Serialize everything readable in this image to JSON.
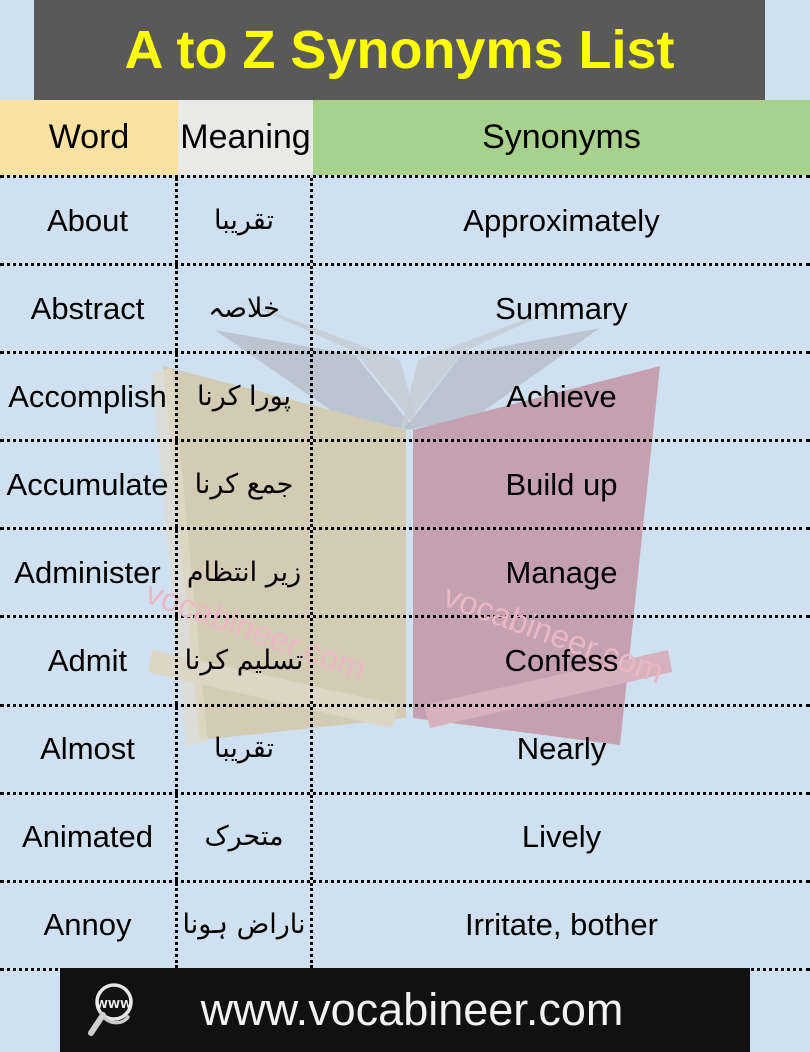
{
  "title": {
    "text": "A to Z Synonyms List",
    "bar_color": "#595959",
    "text_color": "#ffff00"
  },
  "table": {
    "headers": {
      "word": "Word",
      "meaning": "Meaning",
      "synonyms": "Synonyms"
    },
    "header_colors": {
      "word": "#fce2a2",
      "meaning": "#e9e9e7",
      "synonyms": "#a9d18e"
    },
    "rows": [
      {
        "word": "About",
        "meaning": "تقریبا",
        "synonyms": "Approximately"
      },
      {
        "word": "Abstract",
        "meaning": "خلاصہ",
        "synonyms": "Summary"
      },
      {
        "word": "Accomplish",
        "meaning": "پورا کرنا",
        "synonyms": "Achieve"
      },
      {
        "word": "Accumulate",
        "meaning": "جمع کرنا",
        "synonyms": "Build up"
      },
      {
        "word": "Administer",
        "meaning": "زیر انتظام",
        "synonyms": "Manage"
      },
      {
        "word": "Admit",
        "meaning": "تسلیم کرنا",
        "synonyms": "Confess"
      },
      {
        "word": "Almost",
        "meaning": "تقریبا",
        "synonyms": "Nearly"
      },
      {
        "word": "Animated",
        "meaning": "متحرک",
        "synonyms": "Lively"
      },
      {
        "word": "Annoy",
        "meaning": "ناراض ہونا",
        "synonyms": "Irritate, bother"
      }
    ]
  },
  "watermark": {
    "text": "vocabineer.com",
    "color": "#e9b8c4"
  },
  "footer": {
    "url": "www.vocabineer.com",
    "icon_label": "WWW",
    "bar_color": "#111111",
    "text_color": "#f2f2f2"
  },
  "background": {
    "page_color": "#cfe0f0",
    "book_left_page": "#d4cbb5",
    "book_right_page": "#c4a0b0",
    "book_fan_pages": "#b6bfcb"
  }
}
